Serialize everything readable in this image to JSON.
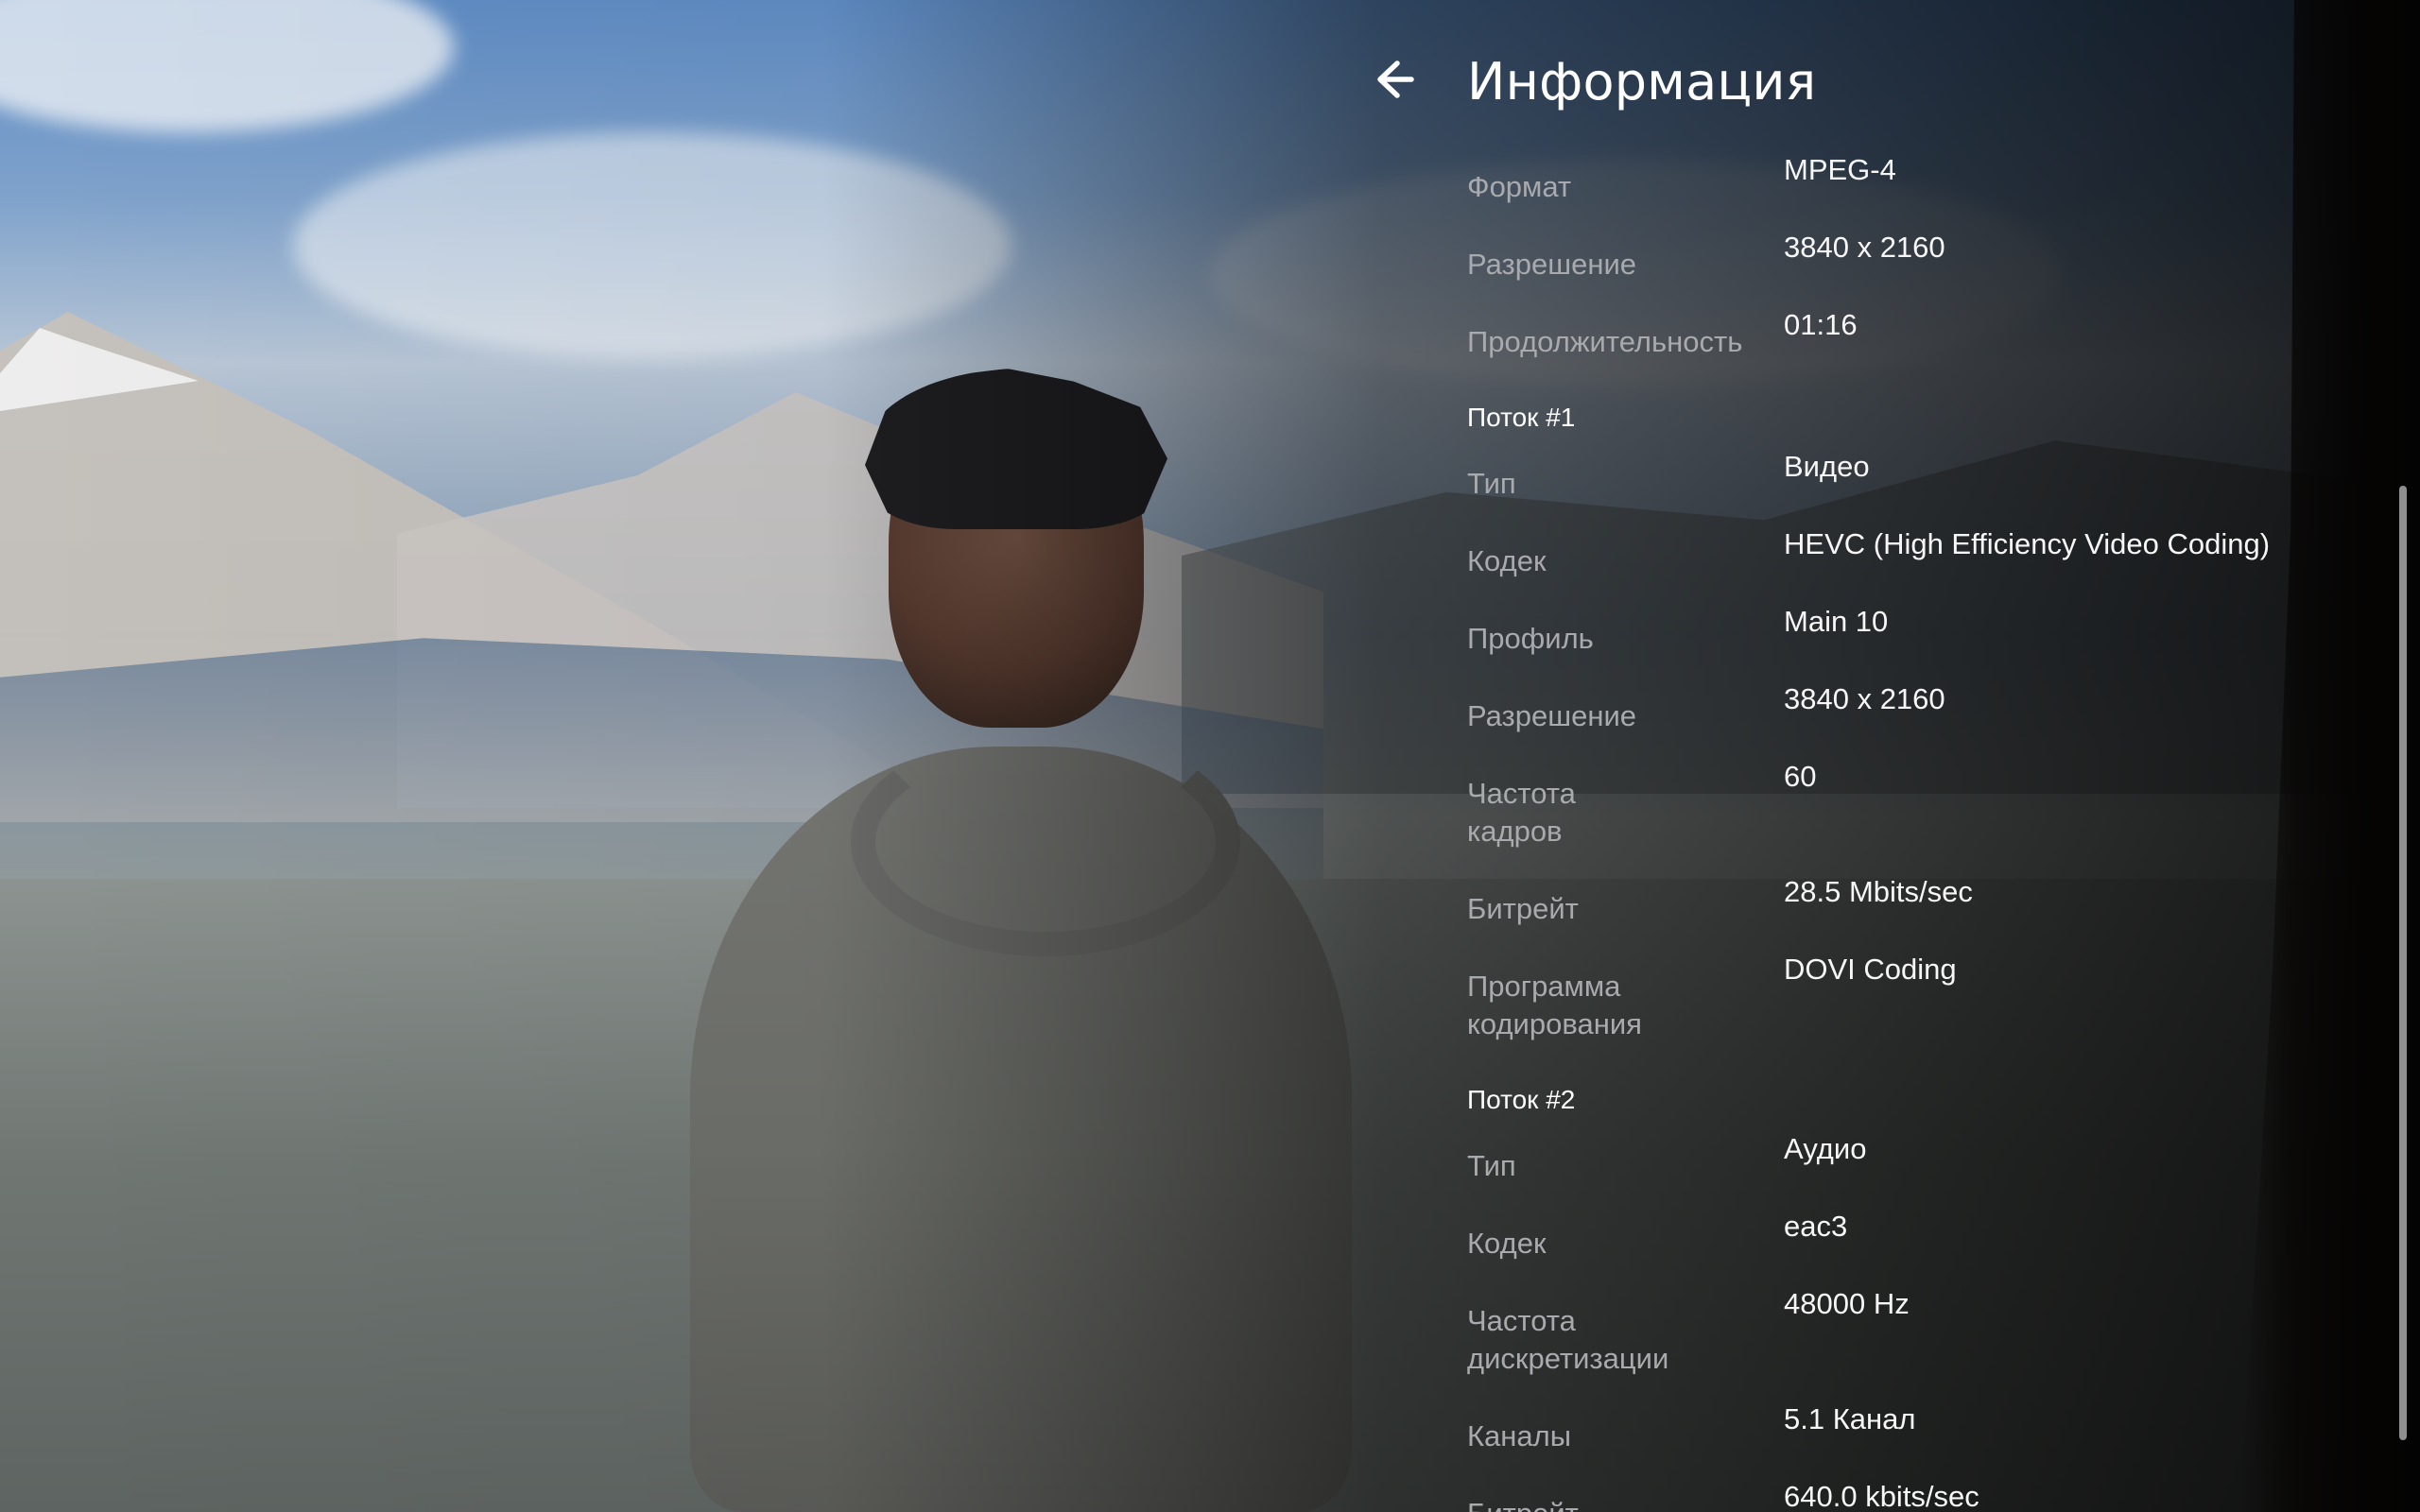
{
  "panel": {
    "title": "Информация"
  },
  "general": [
    {
      "label": "Формат",
      "value": "MPEG-4"
    },
    {
      "label": "Разрешение",
      "value": "3840 x 2160"
    },
    {
      "label": "Продолжительность",
      "value": "01:16"
    }
  ],
  "streams": [
    {
      "title": "Поток #1",
      "rows": [
        {
          "label": "Тип",
          "value": "Видео"
        },
        {
          "label": "Кодек",
          "value": "HEVC (High Efficiency Video Coding)"
        },
        {
          "label": "Профиль",
          "value": "Main 10"
        },
        {
          "label": "Разрешение",
          "value": "3840 x 2160"
        },
        {
          "label_line1": "Частота",
          "label_line2": "кадров",
          "value": "60"
        },
        {
          "label": "Битрейт",
          "value": "28.5 Mbits/sec"
        },
        {
          "label_line1": "Программа",
          "label_line2": "кодирования",
          "value": " DOVI Coding"
        }
      ]
    },
    {
      "title": "Поток #2",
      "rows": [
        {
          "label": "Тип",
          "value": "Аудио"
        },
        {
          "label": "Кодек",
          "value": "eac3"
        },
        {
          "label_line1": "Частота",
          "label_line2": "дискретизации",
          "value": "48000 Hz"
        },
        {
          "label": "Каналы",
          "value": "5.1 Канал"
        },
        {
          "label": "Битрейт",
          "value": "640.0 kbits/sec"
        }
      ]
    }
  ],
  "icons": {
    "back": "arrow-left-icon"
  }
}
